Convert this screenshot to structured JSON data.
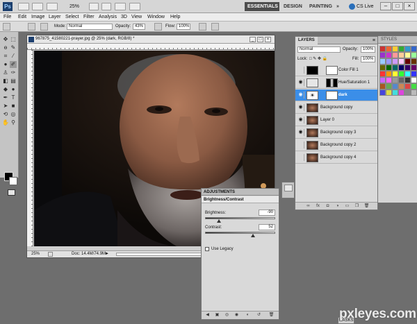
{
  "appbar": {
    "zoom": "25%",
    "workspaces": [
      "ESSENTIALS",
      "DESIGN",
      "PAINTING"
    ],
    "active_workspace": "ESSENTIALS",
    "more": "»",
    "cs_live": "CS Live"
  },
  "menu": [
    "File",
    "Edit",
    "Image",
    "Layer",
    "Select",
    "Filter",
    "Analysis",
    "3D",
    "View",
    "Window",
    "Help"
  ],
  "options": {
    "mode_label": "Mode:",
    "mode_value": "Normal",
    "opacity_label": "Opacity:",
    "opacity_value": "43%",
    "flow_label": "Flow:",
    "flow_value": "100%"
  },
  "document": {
    "title": "967875_41580221-prayer.jpg @ 25% (dark, RGB/8) *",
    "status_zoom": "25%",
    "status_doc": "Doc: 14.4M/74.9M"
  },
  "layers": {
    "tab": "LAYERS",
    "blend_mode": "Normal",
    "opacity_label": "Opacity:",
    "opacity_value": "100%",
    "lock_label": "Lock:",
    "fill_label": "Fill:",
    "fill_value": "100%",
    "items": [
      {
        "name": "Color Fill 1",
        "visible": false,
        "selected": false,
        "kind": "fill"
      },
      {
        "name": "Hue/Saturation 1",
        "visible": true,
        "selected": false,
        "kind": "adjust"
      },
      {
        "name": "dark",
        "visible": true,
        "selected": true,
        "kind": "brightness"
      },
      {
        "name": "Background copy",
        "visible": true,
        "selected": false,
        "kind": "photo"
      },
      {
        "name": "Layer 0",
        "visible": true,
        "selected": false,
        "kind": "photo"
      },
      {
        "name": "Background copy 3",
        "visible": true,
        "selected": false,
        "kind": "photo"
      },
      {
        "name": "Background copy 2",
        "visible": false,
        "selected": false,
        "kind": "photo"
      },
      {
        "name": "Background copy 4",
        "visible": false,
        "selected": false,
        "kind": "photo"
      }
    ]
  },
  "styles_tab": "STYLES",
  "adjustments": {
    "tab": "ADJUSTMENTS",
    "header": "Brightness/Contrast",
    "brightness_label": "Brightness:",
    "brightness_value": "-90",
    "contrast_label": "Contrast:",
    "contrast_value": "52",
    "legacy_label": "Use Legacy"
  },
  "masks_tab": "MASKS",
  "watermark": "pxleyes.com",
  "colors": {
    "accent": "#3b8ee8",
    "workspace_active": "#4d4d4d"
  }
}
